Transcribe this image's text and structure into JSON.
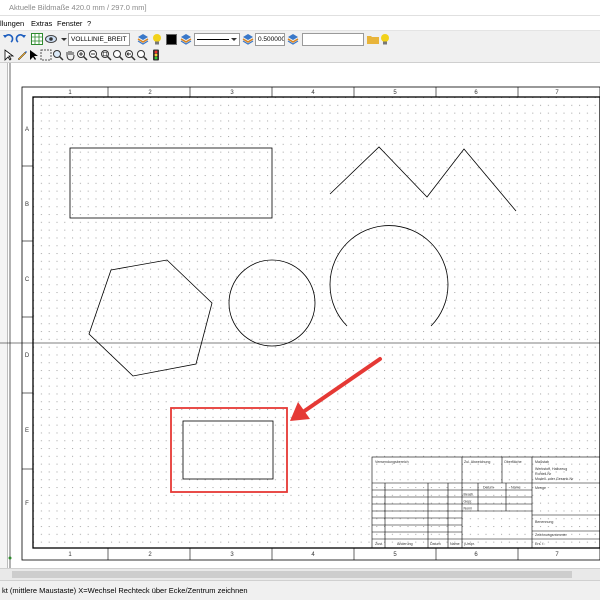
{
  "window": {
    "title": "Aktuelle Bildmaße 420.0 mm / 297.0 mm]"
  },
  "menu": {
    "items": [
      "llungen",
      "Extras",
      "Fenster",
      "?"
    ]
  },
  "toolbar": {
    "line_type": "VOLLLINIE_BREIT",
    "line_width": "0.500000",
    "text_field": "",
    "color_swatch": "#000000"
  },
  "drawing_frame": {
    "columns": [
      "1",
      "2",
      "3",
      "4",
      "5",
      "6",
      "7"
    ],
    "rows": [
      "A",
      "B",
      "C",
      "D",
      "E",
      "F"
    ]
  },
  "title_block": {
    "row1": [
      "Verwendungsbereich",
      "Zul. Abweichung",
      "Oberfläche",
      "Maßstab"
    ],
    "right_labels": [
      "Werkstoff, Halbzeug",
      "Rohteil-Nr",
      "Modell- oder Gesenk-Nr"
    ],
    "mengen": "Menge",
    "datum_name": [
      "Datum",
      "Name"
    ],
    "people": [
      "Bearb.",
      "Gepr.",
      "Norm"
    ],
    "benennung": "Benennung",
    "zeichnungsnummer": "Zeichnungsnummer",
    "bottom_row": [
      "Zust.",
      "Änderung",
      "Datum",
      "Name",
      "(Urspr.",
      "Ers. f.:"
    ]
  },
  "status": {
    "message": "kt (mittlere Maustaste) X=Wechsel Rechteck über Ecke/Zentrum zeichnen"
  },
  "colors": {
    "annotation_arrow": "#e53935",
    "grid_dot": "#9a9a9a"
  }
}
